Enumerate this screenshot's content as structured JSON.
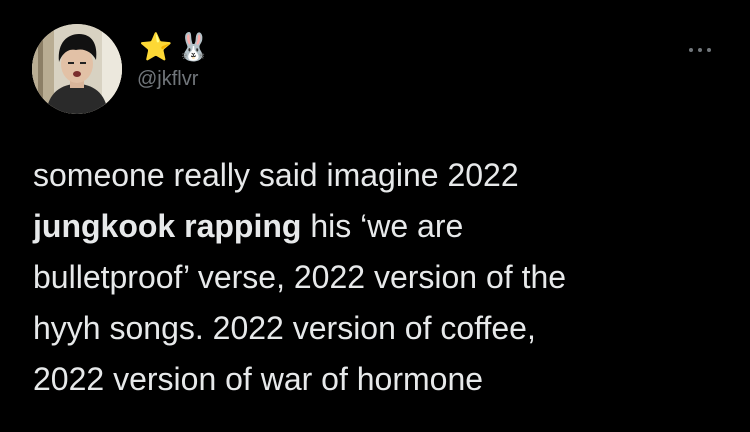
{
  "author": {
    "display_name_emoji": [
      "⭐",
      "🐰"
    ],
    "handle": "@jkflvr",
    "avatar_icon": "profile-photo"
  },
  "more_icon": "more-horizontal-icon",
  "tweet": {
    "line1": "someone really said imagine 2022",
    "line2_bold": "jungkook rapping",
    "line2_rest": " his ‘we are",
    "line3": "bulletproof’ verse, 2022 version of the",
    "line4": "hyyh songs. 2022 version of coffee,",
    "line5": "2022 version of war of hormone"
  },
  "colors": {
    "background": "#000000",
    "text": "#e7e9ea",
    "secondary": "#71767b"
  }
}
